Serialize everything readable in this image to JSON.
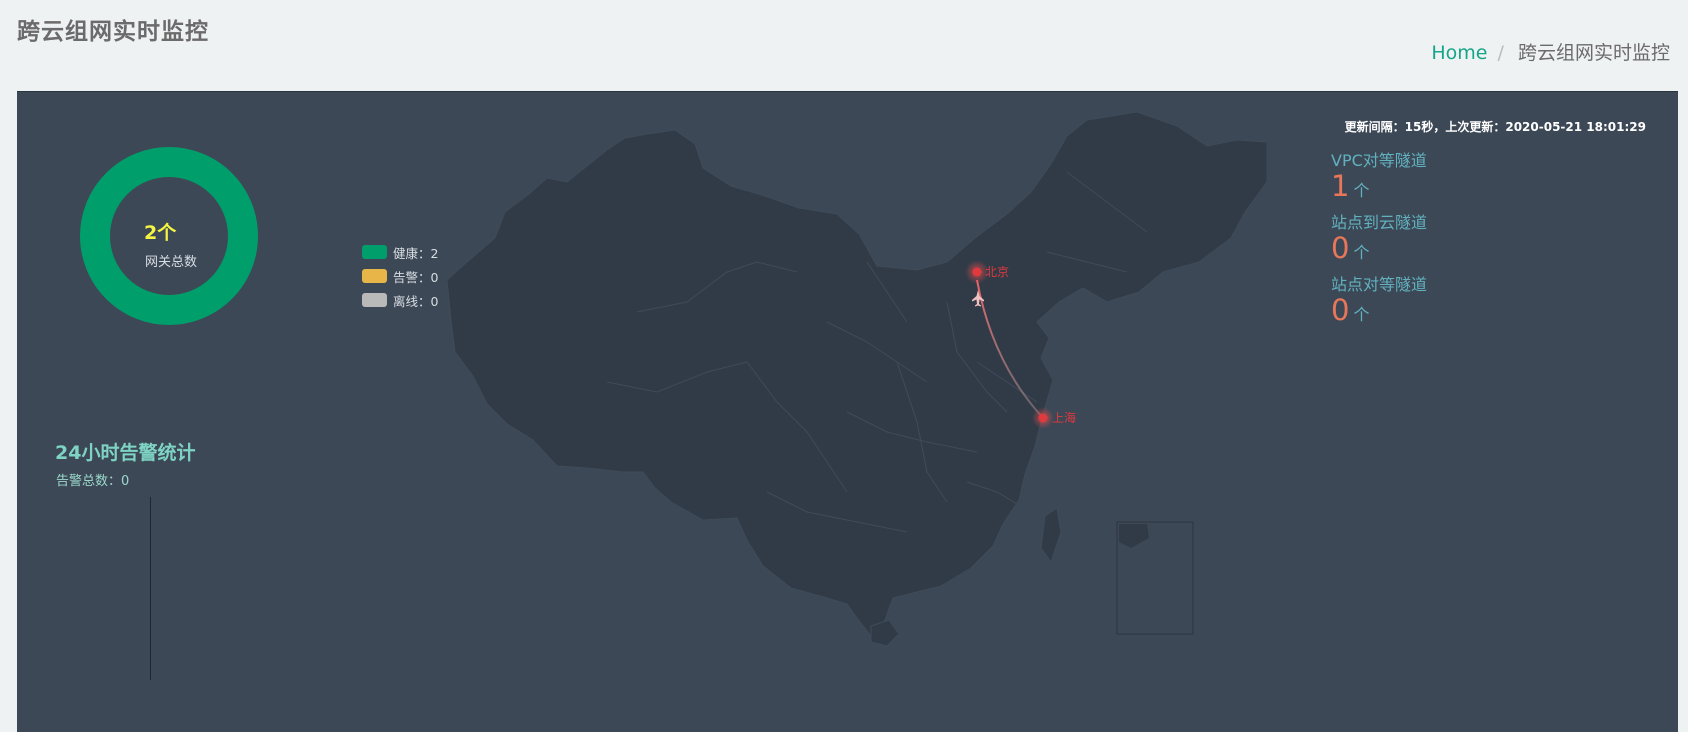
{
  "header": {
    "title": "跨云组网实时监控",
    "breadcrumb": {
      "home": "Home",
      "separator": "/",
      "current": "跨云组网实时监控"
    }
  },
  "update_info": "更新间隔：15秒，上次更新：2020-05-21 18:01:29",
  "gateway_summary": {
    "count": "2个",
    "label": "网关总数",
    "ring_color": "#009e6a"
  },
  "legend": [
    {
      "label": "健康：2",
      "color": "#009e6a"
    },
    {
      "label": "告警：0",
      "color": "#e8b548"
    },
    {
      "label": "离线：0",
      "color": "#b9b9b9"
    }
  ],
  "alarm_stats": {
    "title": "24小时告警统计",
    "total": "告警总数：0"
  },
  "map": {
    "nodes": [
      {
        "name": "北京",
        "color": "#e0393e"
      },
      {
        "name": "上海",
        "color": "#e0393e"
      }
    ],
    "route_icon": "plane-icon"
  },
  "tunnels": [
    {
      "label": "VPC对等隧道",
      "value": "1",
      "unit": "个"
    },
    {
      "label": "站点到云隧道",
      "value": "0",
      "unit": "个"
    },
    {
      "label": "站点对等隧道",
      "value": "0",
      "unit": "个"
    }
  ]
}
